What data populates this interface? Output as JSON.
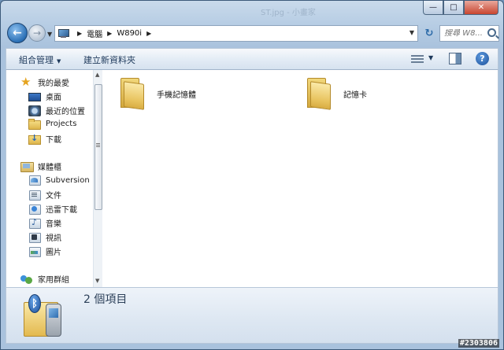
{
  "window": {
    "title_text": "",
    "title_blur_right": "ST.jpg - 小畫家",
    "buttons": {
      "minimize": "—",
      "maximize": "□",
      "close": "✕"
    }
  },
  "address": {
    "crumbs": [
      "電腦",
      "W890i"
    ],
    "search_placeholder": "搜尋 W8..."
  },
  "toolbar": {
    "organize": "組合管理",
    "new_folder": "建立新資料夾",
    "help": "?"
  },
  "nav": {
    "favorites_header": "我的最愛",
    "favorites": [
      {
        "label": "桌面",
        "icon": "desktop-icon"
      },
      {
        "label": "最近的位置",
        "icon": "recent-places-icon"
      },
      {
        "label": "Projects",
        "icon": "folder-icon"
      },
      {
        "label": "下載",
        "icon": "downloads-icon"
      }
    ],
    "libraries_header": "媒體櫃",
    "libraries": [
      {
        "label": "Subversion",
        "icon": "subversion-library-icon"
      },
      {
        "label": "文件",
        "icon": "documents-icon"
      },
      {
        "label": "迅雷下載",
        "icon": "thunder-download-icon"
      },
      {
        "label": "音樂",
        "icon": "music-icon"
      },
      {
        "label": "視訊",
        "icon": "video-icon"
      },
      {
        "label": "圖片",
        "icon": "pictures-icon"
      }
    ],
    "homegroup": "家用群組"
  },
  "files": [
    {
      "name": "手機記憶體"
    },
    {
      "name": "記憶卡"
    }
  ],
  "details": {
    "item_count": "2 個項目"
  },
  "watermark": "#2303806"
}
